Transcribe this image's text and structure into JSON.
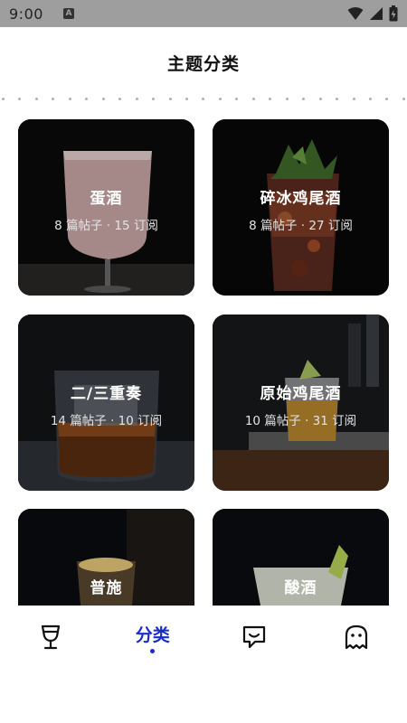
{
  "status_bar": {
    "time": "9:00",
    "notification_badge": "A",
    "icons": [
      "wifi-icon",
      "signal-icon",
      "battery-icon"
    ]
  },
  "header": {
    "title": "主题分类"
  },
  "categories": [
    {
      "name": "蛋酒",
      "meta": "8 篇帖子 · 15 订阅",
      "image": "eggnog-glass-image"
    },
    {
      "name": "碎冰鸡尾酒",
      "meta": "8 篇帖子 · 27 订阅",
      "image": "crushed-ice-cocktail-image"
    },
    {
      "name": "二/三重奏",
      "meta": "14 篇帖子 · 10 订阅",
      "image": "duo-trio-glass-image"
    },
    {
      "name": "原始鸡尾酒",
      "meta": "10 篇帖子 · 31 订阅",
      "image": "original-cocktail-image"
    },
    {
      "name": "普施",
      "meta": "",
      "image": "pousse-glass-image"
    },
    {
      "name": "酸酒",
      "meta": "",
      "image": "sour-glass-image"
    }
  ],
  "bottom_nav": {
    "items": [
      {
        "id": "home",
        "icon": "wine-glass-icon",
        "label": ""
      },
      {
        "id": "categories",
        "icon": "",
        "label": "分类",
        "active": true
      },
      {
        "id": "messages",
        "icon": "chat-bubble-icon",
        "label": ""
      },
      {
        "id": "profile",
        "icon": "ghost-icon",
        "label": ""
      }
    ]
  },
  "colors": {
    "accent": "#1a2cc8",
    "status_bar": "#9e9e9e"
  }
}
